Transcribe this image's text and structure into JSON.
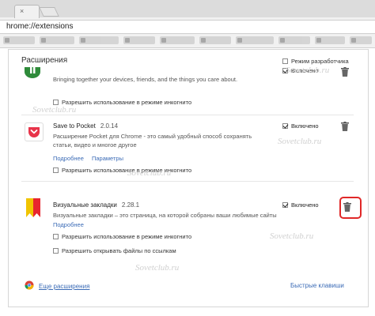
{
  "browser": {
    "url": "hrome://extensions",
    "tab_close": "×"
  },
  "page": {
    "title": "Расширения",
    "dev_mode_label": "Режим разработчика"
  },
  "extensions": [
    {
      "name": "",
      "version": "",
      "description": "Bringing together your devices, friends, and the things you care about.",
      "links": [],
      "options": [
        "Разрешить использование в режиме инкогнито"
      ],
      "enabled_label": "Включено",
      "icon_color": "#2e8b3a"
    },
    {
      "name": "Save to Pocket",
      "version": "2.0.14",
      "description": "Расширение Pocket для Chrome - это самый удобный способ сохранять статьи, видео и многое другое",
      "links": [
        "Подробнее",
        "Параметры"
      ],
      "options": [
        "Разрешить использование в режиме инкогнито"
      ],
      "enabled_label": "Включено",
      "icon_color": "#e8344a"
    },
    {
      "name": "Визуальные закладки",
      "version": "2.28.1",
      "description": "Визуальные закладки – это страница, на которой собраны ваши любимые сайты",
      "links": [
        "Подробнее"
      ],
      "options": [
        "Разрешить использование в режиме инкогнито",
        "Разрешить открывать файлы по ссылкам"
      ],
      "enabled_label": "Включено",
      "icon_color": "#f0c400"
    }
  ],
  "footer": {
    "more_extensions": "Еще расширения",
    "shortcuts": "Быстрые клавиши"
  },
  "watermark": "Sovetclub.ru",
  "colors": {
    "link": "#3b6bb6",
    "highlight": "#e02828"
  }
}
